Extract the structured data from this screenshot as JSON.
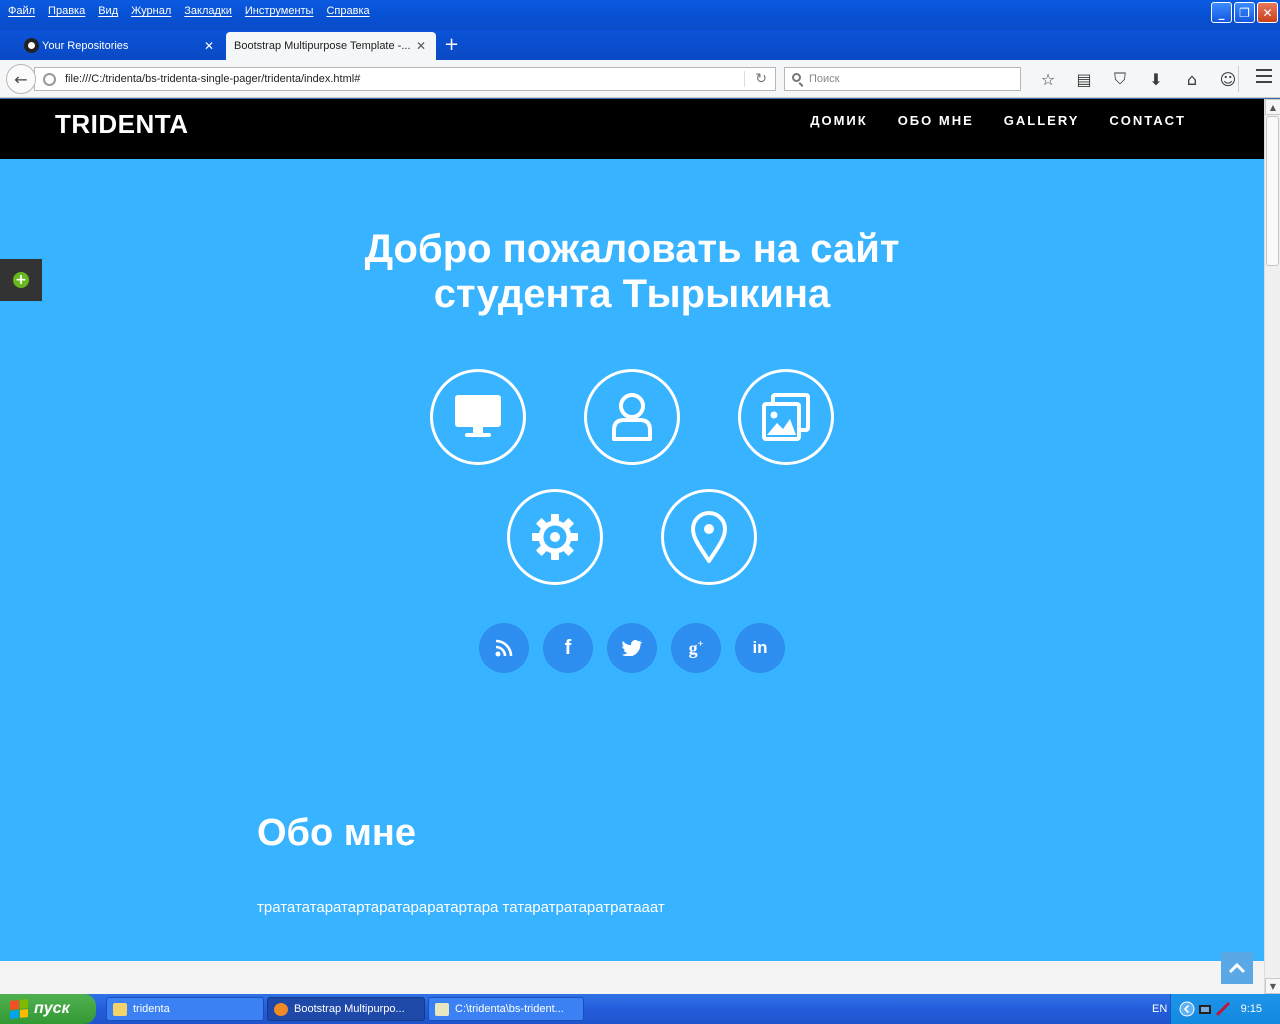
{
  "browser": {
    "menu": [
      "Файл",
      "Правка",
      "Вид",
      "Журнал",
      "Закладки",
      "Инструменты",
      "Справка"
    ],
    "tabs": [
      {
        "label": "Your Repositories",
        "active": false
      },
      {
        "label": "Bootstrap Multipurpose Template -...",
        "active": true
      }
    ],
    "url": "file:///C:/tridenta/bs-tridenta-single-pager/tridenta/index.html#",
    "search_placeholder": "Поиск"
  },
  "site": {
    "logo": "TRIDENTA",
    "nav": [
      "ДОМИК",
      "ОБО МНЕ",
      "GALLERY",
      "CONTACT"
    ],
    "hero_line1": "Добро пожаловать на сайт",
    "hero_line2": "студента Тырыкина",
    "feature_icons": [
      "monitor-icon",
      "user-icon",
      "gallery-icon",
      "gear-icon",
      "map-pin-icon"
    ],
    "social_icons": [
      "rss-icon",
      "facebook-icon",
      "twitter-icon",
      "google-plus-icon",
      "linkedin-icon"
    ],
    "about_title": "Обо мне",
    "about_text": "тратататаратартаратараратартара татаратратаратратааат",
    "accent_color": "#38b3ff"
  },
  "taskbar": {
    "start": "пуск",
    "tasks": [
      "tridenta",
      "Bootstrap Multipurpo...",
      "C:\\tridenta\\bs-trident..."
    ],
    "lang": "EN",
    "clock": "9:15"
  }
}
